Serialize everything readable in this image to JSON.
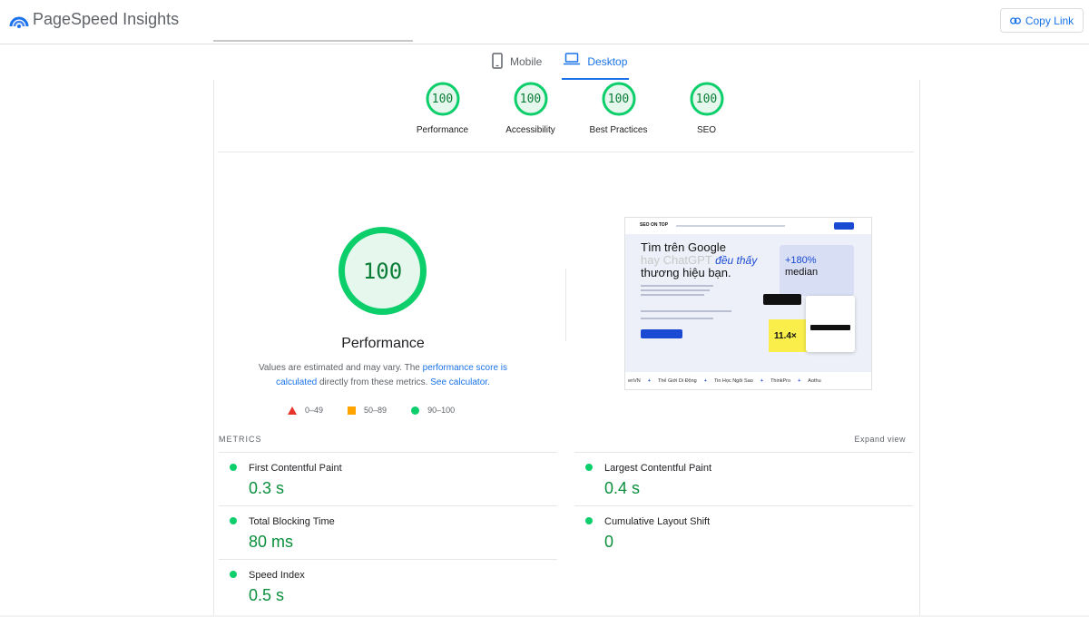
{
  "app": {
    "title": "PageSpeed Insights",
    "copy_link_label": "Copy Link"
  },
  "tabs": [
    {
      "label": "Mobile",
      "icon": "smartphone-icon",
      "active": false
    },
    {
      "label": "Desktop",
      "icon": "laptop-icon",
      "active": true
    }
  ],
  "categories": [
    {
      "score": "100",
      "score_value": 100,
      "label": "Performance"
    },
    {
      "score": "100",
      "score_value": 100,
      "label": "Accessibility"
    },
    {
      "score": "100",
      "score_value": 100,
      "label": "Best Practices"
    },
    {
      "score": "100",
      "score_value": 100,
      "label": "SEO"
    }
  ],
  "performance": {
    "score": "100",
    "score_value": 100,
    "title": "Performance",
    "note_prefix": "Values are estimated and may vary. The ",
    "note_link1": "performance score is calculated",
    "note_mid": " directly from these metrics. ",
    "note_link2": "See calculator.",
    "legend": [
      {
        "range": "0–49",
        "shape": "triangle",
        "color": "#e8332a"
      },
      {
        "range": "50–89",
        "shape": "square",
        "color": "#ffa400"
      },
      {
        "range": "90–100",
        "shape": "circle",
        "color": "#0cce6b"
      }
    ]
  },
  "screenshot": {
    "brand": "SEO ON TOP",
    "headline1": "Tìm trên Google",
    "headline2_gray": "hay ChatGPT",
    "headline2_blue": "đều thấy",
    "headline3": "thương hiệu bạn.",
    "stat_value": "+180%",
    "stat_label": "median",
    "yellow_value": "11.4×",
    "ticker": [
      "enVN",
      "Thế Giới Di Động",
      "Tin Học Ngôi Sao",
      "ThinkPro",
      "Aothu"
    ]
  },
  "metrics": {
    "header": "METRICS",
    "expand_label": "Expand view",
    "left": [
      {
        "label": "First Contentful Paint",
        "value": "0.3 s"
      },
      {
        "label": "Total Blocking Time",
        "value": "80 ms"
      },
      {
        "label": "Speed Index",
        "value": "0.5 s"
      }
    ],
    "right": [
      {
        "label": "Largest Contentful Paint",
        "value": "0.4 s"
      },
      {
        "label": "Cumulative Layout Shift",
        "value": "0"
      }
    ]
  },
  "colors": {
    "pass": "#0cce6b",
    "pass_text": "#0a8f3c",
    "accent": "#1a73e8"
  }
}
